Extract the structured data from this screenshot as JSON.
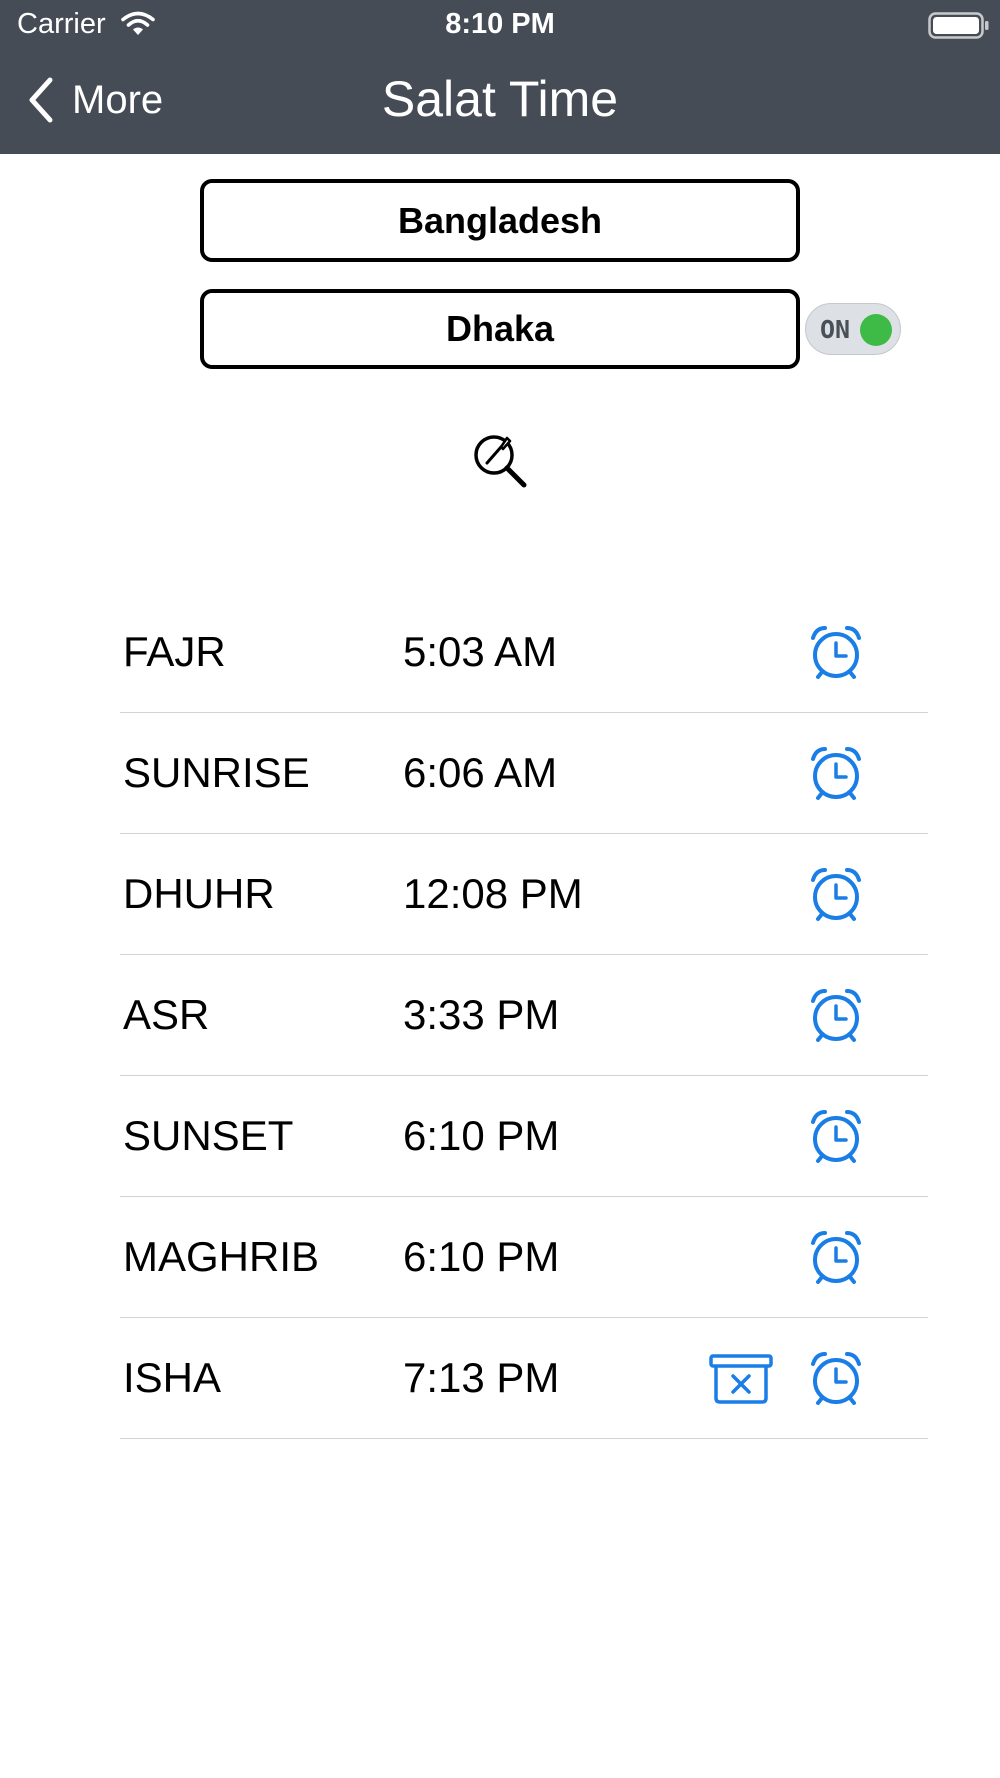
{
  "status_bar": {
    "carrier": "Carrier",
    "time": "8:10 PM"
  },
  "nav": {
    "back_label": "More",
    "title": "Salat Time"
  },
  "location": {
    "country": "Bangladesh",
    "city": "Dhaka",
    "toggle_label": "ON"
  },
  "prayers": [
    {
      "name": "FAJR",
      "time": "5:03 AM"
    },
    {
      "name": "SUNRISE",
      "time": "6:06 AM"
    },
    {
      "name": "DHUHR",
      "time": "12:08 PM"
    },
    {
      "name": "ASR",
      "time": "3:33 PM"
    },
    {
      "name": "SUNSET",
      "time": "6:10 PM"
    },
    {
      "name": "MAGHRIB",
      "time": "6:10 PM"
    },
    {
      "name": "ISHA",
      "time": "7:13 PM"
    }
  ],
  "colors": {
    "header_bg": "#464c55",
    "accent_blue": "#1a7ee6",
    "toggle_on": "#3dbb46"
  },
  "icons": {
    "wifi": "wifi-icon",
    "battery": "battery-icon",
    "back": "chevron-left-icon",
    "search": "search-icon",
    "alarm": "alarm-clock-icon",
    "trash": "trash-icon"
  }
}
